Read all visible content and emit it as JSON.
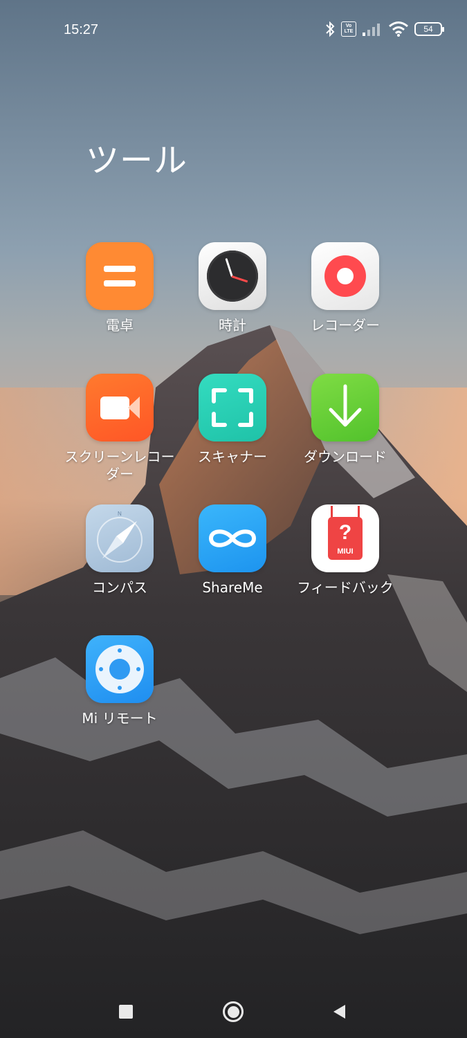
{
  "status_bar": {
    "time": "15:27",
    "volte_label": "Vo\nLTE",
    "battery_level": "54"
  },
  "folder": {
    "title": "ツール"
  },
  "apps": [
    {
      "label": "電卓",
      "icon": "calculator-icon",
      "color": "#ff8a33"
    },
    {
      "label": "時計",
      "icon": "clock-icon",
      "color": "#ececec"
    },
    {
      "label": "レコーダー",
      "icon": "recorder-icon",
      "color": "#f2f2f2"
    },
    {
      "label": "スクリーンレコーダー",
      "icon": "video-camera-icon",
      "color": "#ff6a2a"
    },
    {
      "label": "スキャナー",
      "icon": "scanner-icon",
      "color": "#27d1b4"
    },
    {
      "label": "ダウンロード",
      "icon": "download-arrow-icon",
      "color": "#6bd13a"
    },
    {
      "label": "コンパス",
      "icon": "compass-icon",
      "color": "#b6cde2"
    },
    {
      "label": "ShareMe",
      "icon": "infinity-icon",
      "color": "#2aa7f5"
    },
    {
      "label": "フィードバック",
      "icon": "feedback-question-icon",
      "color": "#ffffff",
      "badge": "MIUI"
    },
    {
      "label": "Mi リモート",
      "icon": "remote-icon",
      "color": "#2b9cf5"
    }
  ]
}
